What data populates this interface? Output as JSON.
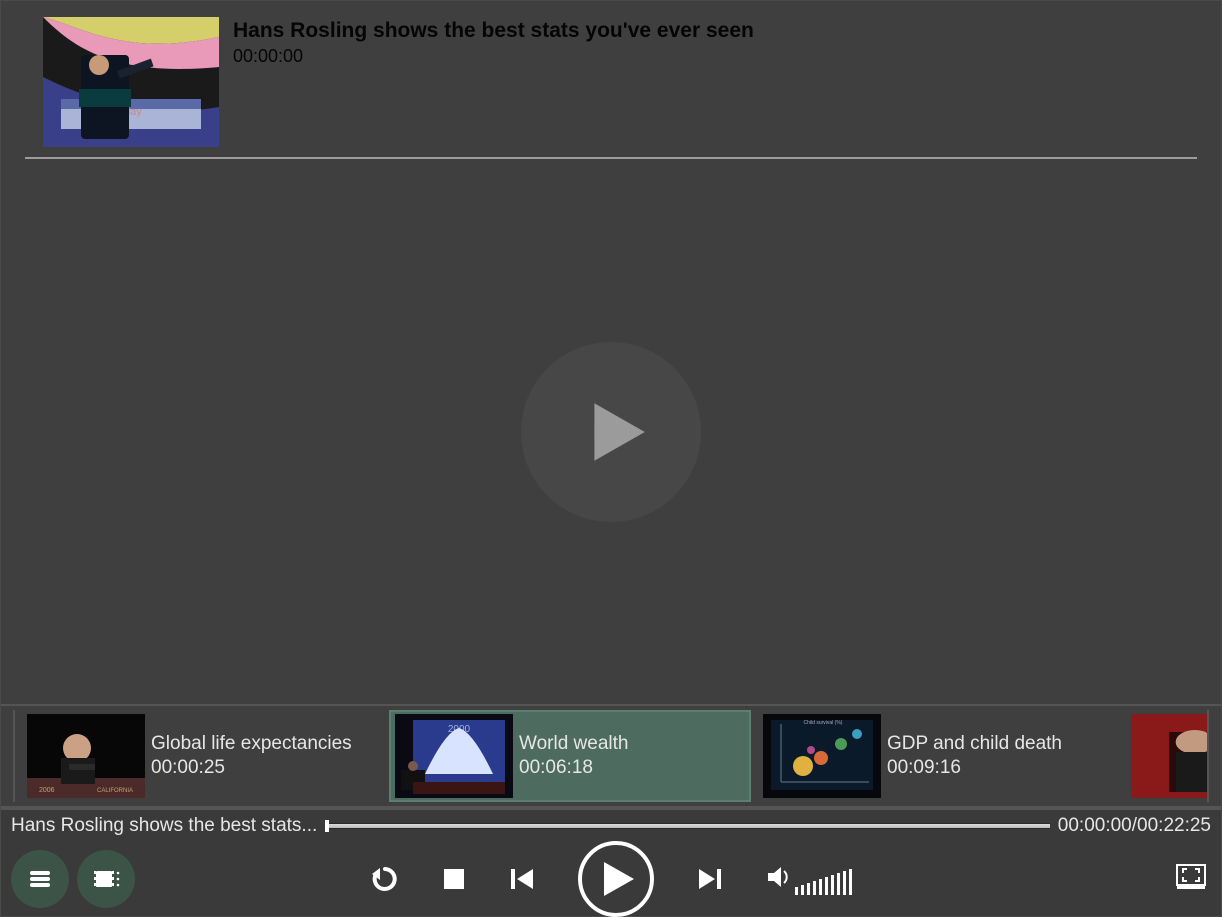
{
  "colors": {
    "accent": "#3c5348",
    "selected_bg": "#4e6b5f",
    "bg": "#3f3f3f",
    "text_light": "#e6e6e6"
  },
  "header": {
    "title": "Hans Rosling shows the best stats you've ever seen",
    "time": "00:00:00"
  },
  "chapters": [
    {
      "title": "Global life expectancies",
      "time": "00:00:25",
      "selected": false
    },
    {
      "title": "World wealth",
      "time": "00:06:18",
      "selected": true
    },
    {
      "title": "GDP and child death",
      "time": "00:09:16",
      "selected": false
    }
  ],
  "playback": {
    "now_playing_title": "Hans Rosling shows the best stats...",
    "current_time": "00:00:00",
    "total_time": "00:22:25",
    "time_separator": "/"
  },
  "icons": {
    "list": "list-icon",
    "chapters": "chapters-icon",
    "replay": "replay-icon",
    "stop": "stop-icon",
    "prev": "prev-icon",
    "play": "play-icon",
    "next": "next-icon",
    "volume": "volume-icon",
    "fullscreen": "fullscreen-icon"
  }
}
